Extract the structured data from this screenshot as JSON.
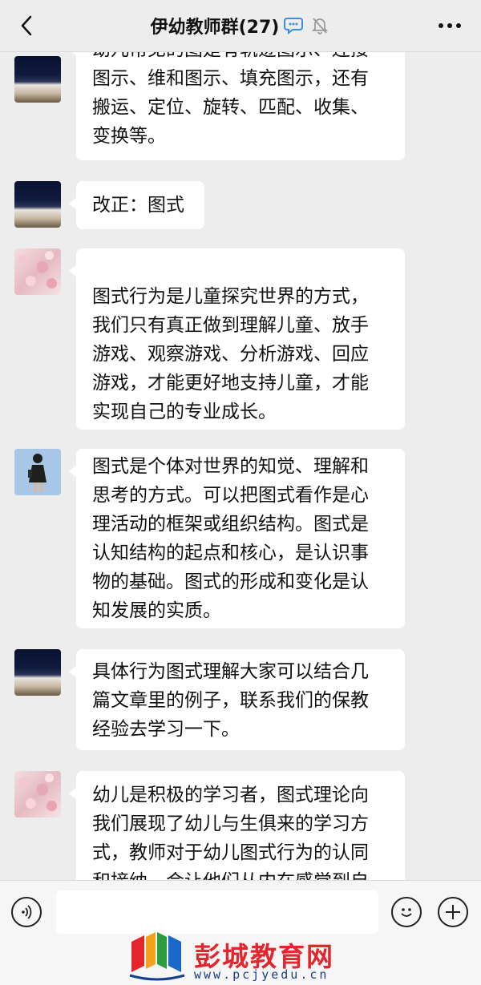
{
  "header": {
    "title": "伊幼教师群(27)",
    "icons": [
      "back-arrow-icon",
      "chat-bubble-icon",
      "mute-bell-icon",
      "more-dots-icon"
    ]
  },
  "messages": [
    {
      "avatar": "stadium",
      "lines": [
        "幼儿常见的图是有轨迹图示、连接",
        "图示、维和图示、填充图示，还有",
        "搬运、定位、旋转、匹配、收集、",
        "变换等。"
      ]
    },
    {
      "avatar": "stadium",
      "lines": [
        "改正：图式"
      ]
    },
    {
      "avatar": "flowers",
      "lines": [
        "图式行为是儿童探究世界的方式，",
        "我们只有真正做到理解儿童、放手",
        "游戏、观察游戏、分析游戏、回应",
        "游戏，才能更好地支持儿童，才能",
        "实现自己的专业成长。"
      ]
    },
    {
      "avatar": "person",
      "lines": [
        "图式是个体对世界的知觉、理解和",
        "思考的方式。可以把图式看作是心",
        "理活动的框架或组织结构。图式是",
        "认知结构的起点和核心，是认识事",
        "物的基础。图式的形成和变化是认",
        "知发展的实质。"
      ]
    },
    {
      "avatar": "stadium",
      "lines": [
        "具体行为图式理解大家可以结合几",
        "篇文章里的例子，联系我们的保教",
        "经验去学习一下。"
      ]
    },
    {
      "avatar": "flowers",
      "lines": [
        "幼儿是积极的学习者，图式理论向",
        "我们展现了幼儿与生俱来的学习方",
        "式，教师对于幼儿图式行为的认同",
        "和接纳，会让他们从内在感觉到自"
      ]
    }
  ],
  "input_bar": {
    "text_value": "",
    "icons": [
      "voice-icon",
      "emoji-icon",
      "plus-icon"
    ]
  },
  "watermark": {
    "text": "彭城教育网",
    "url": "www.pcjyedu.cn"
  },
  "colors": {
    "background": "#ededed",
    "bubble": "#ffffff",
    "watermark_red": "#e3262e"
  }
}
